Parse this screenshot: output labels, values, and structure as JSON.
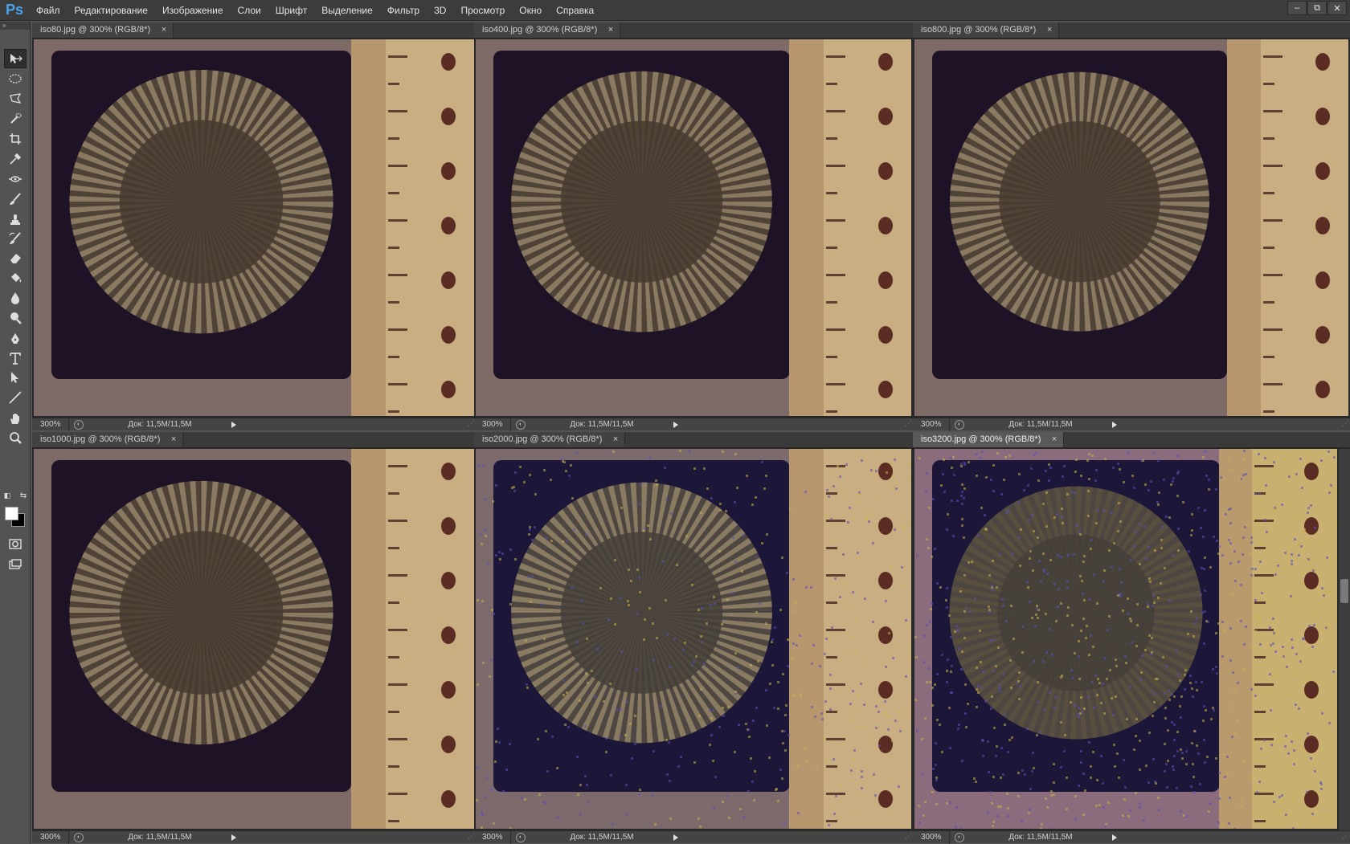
{
  "app": {
    "logo": "Ps"
  },
  "menu": [
    "Файл",
    "Редактирование",
    "Изображение",
    "Слои",
    "Шрифт",
    "Выделение",
    "Фильтр",
    "3D",
    "Просмотр",
    "Окно",
    "Справка"
  ],
  "window_controls": [
    "–",
    "⧉",
    "✕"
  ],
  "tools": [
    {
      "name": "move-tool",
      "icon": "move-icon"
    },
    {
      "name": "marquee-tool",
      "icon": "ellipse-marquee-icon"
    },
    {
      "name": "lasso-tool",
      "icon": "polygonal-lasso-icon"
    },
    {
      "name": "quick-select-tool",
      "icon": "quick-select-icon"
    },
    {
      "name": "crop-tool",
      "icon": "crop-icon"
    },
    {
      "name": "eyedropper-tool",
      "icon": "eyedropper-icon"
    },
    {
      "name": "healing-tool",
      "icon": "healing-icon"
    },
    {
      "name": "brush-tool",
      "icon": "brush-icon"
    },
    {
      "name": "stamp-tool",
      "icon": "stamp-icon"
    },
    {
      "name": "history-brush-tool",
      "icon": "history-brush-icon"
    },
    {
      "name": "eraser-tool",
      "icon": "eraser-icon"
    },
    {
      "name": "paint-bucket-tool",
      "icon": "paint-bucket-icon"
    },
    {
      "name": "blur-tool",
      "icon": "blur-drop-icon"
    },
    {
      "name": "dodge-tool",
      "icon": "dodge-icon"
    },
    {
      "name": "pen-tool",
      "icon": "pen-icon"
    },
    {
      "name": "type-tool",
      "icon": "type-icon"
    },
    {
      "name": "path-select-tool",
      "icon": "path-select-icon"
    },
    {
      "name": "line-tool",
      "icon": "line-icon"
    },
    {
      "name": "hand-tool",
      "icon": "hand-icon"
    },
    {
      "name": "zoom-tool",
      "icon": "zoom-icon"
    }
  ],
  "colors": {
    "foreground": "#ffffff",
    "background": "#000000"
  },
  "documents": [
    {
      "tab": "iso80.jpg @ 300% (RGB/8*)",
      "zoom": "300%",
      "info": "Док: 11,5M/11,5M",
      "active": false,
      "noise": 0
    },
    {
      "tab": "iso400.jpg @ 300% (RGB/8*)",
      "zoom": "300%",
      "info": "Док: 11,5M/11,5M",
      "active": false,
      "noise": 0
    },
    {
      "tab": "iso800.jpg @ 300% (RGB/8*)",
      "zoom": "300%",
      "info": "Док: 11,5M/11,5M",
      "active": false,
      "noise": 0
    },
    {
      "tab": "iso1000.jpg @ 300% (RGB/8*)",
      "zoom": "300%",
      "info": "Док: 11,5M/11,5M",
      "active": false,
      "noise": 0
    },
    {
      "tab": "iso2000.jpg @ 300% (RGB/8*)",
      "zoom": "300%",
      "info": "Док: 11,5M/11,5M",
      "active": false,
      "noise": 0.5
    },
    {
      "tab": "iso3200.jpg @ 300% (RGB/8*)",
      "zoom": "300%",
      "info": "Док: 11,5M/11,5M",
      "active": true,
      "noise": 1
    }
  ]
}
